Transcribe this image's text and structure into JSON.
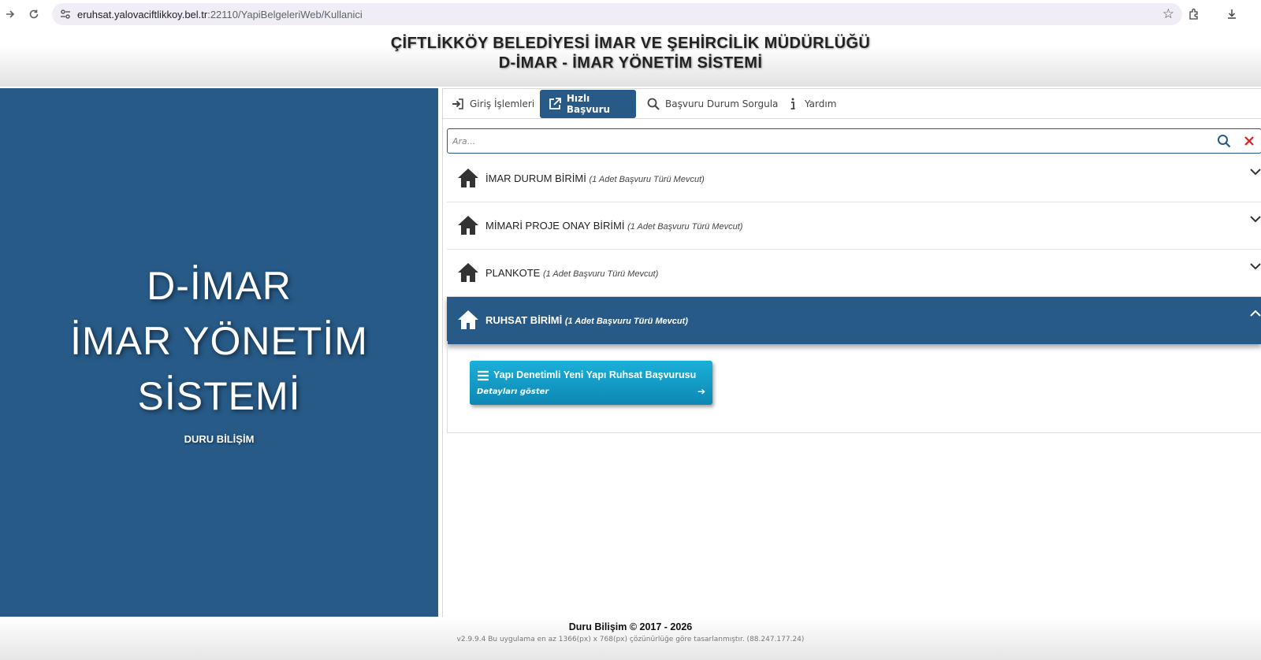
{
  "browser": {
    "url_host": "eruhsat.yalovaciftlikkoy.bel.tr",
    "url_path": ":22110/YapiBelgeleriWeb/Kullanici"
  },
  "header": {
    "line1": "ÇİFTLİKKÖY BELEDİYESİ İMAR VE ŞEHİRCİLİK MÜDÜRLÜĞÜ",
    "line2": "D-İMAR - İMAR YÖNETİM SİSTEMİ"
  },
  "hero": {
    "line1": "D-İMAR",
    "line2": "İMAR YÖNETİM",
    "line3": "SİSTEMİ",
    "company": "DURU BİLİŞİM"
  },
  "tabs": [
    {
      "label": "Giriş İşlemleri",
      "icon": "login-icon"
    },
    {
      "label": "Hızlı Başvuru",
      "icon": "external-link-icon",
      "active": true
    },
    {
      "label": "Başvuru Durum Sorgula",
      "icon": "search-icon"
    },
    {
      "label": "Yardım",
      "icon": "info-icon"
    }
  ],
  "search": {
    "placeholder": "Ara..."
  },
  "units": [
    {
      "name": "İMAR DURUM BİRİMİ",
      "count_text": "(1 Adet Başvuru Türü Mevcut)",
      "open": false
    },
    {
      "name": "MİMARİ PROJE ONAY BİRİMİ",
      "count_text": "(1 Adet Başvuru Türü Mevcut)",
      "open": false
    },
    {
      "name": "PLANKOTE",
      "count_text": "(1 Adet Başvuru Türü Mevcut)",
      "open": false
    },
    {
      "name": "RUHSAT BİRİMİ",
      "count_text": "(1 Adet Başvuru Türü Mevcut)",
      "open": true
    }
  ],
  "application": {
    "title": "Yapı Denetimli Yeni Yapı Ruhsat Başvurusu",
    "detail": "Detayları göster"
  },
  "footer": {
    "copyright": "Duru Bilişim © 2017 - 2026",
    "info": "v2.9.9.4 Bu uygulama en az 1366(px) x 768(px) çözünürlüğe göre tasarlanmıştır. (88.247.177.24)"
  },
  "colors": {
    "brand_blue": "#275a87",
    "card_teal": "#1ab0d8",
    "close_red": "#e02020"
  }
}
